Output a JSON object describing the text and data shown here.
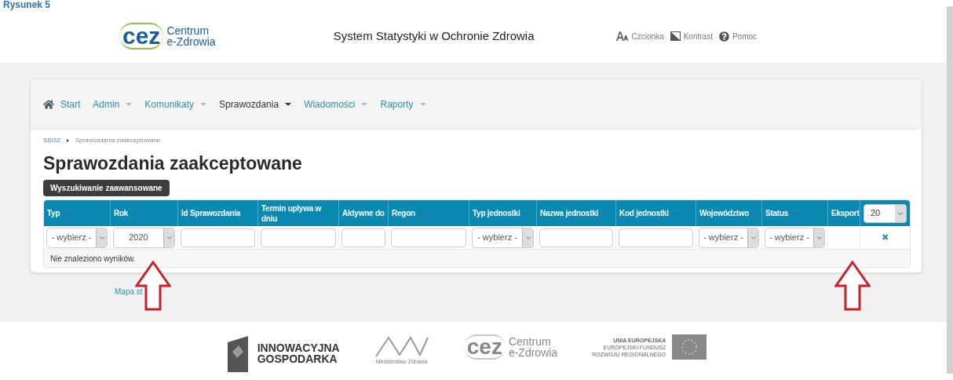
{
  "caption": "Rysunek 5",
  "header": {
    "logo": {
      "mark": "cez",
      "line1": "Centrum",
      "line2": "e-Zdrowia"
    },
    "title": "System Statystyki w Ochronie Zdrowia",
    "tools": [
      {
        "kind": "font",
        "label": "Czcionka"
      },
      {
        "kind": "contrast",
        "label": "Kontrast"
      },
      {
        "kind": "help",
        "label": "Pomoc"
      }
    ]
  },
  "nav": [
    {
      "kind": "home",
      "label": "Start",
      "selected": false
    },
    {
      "kind": "menu",
      "label": "Admin",
      "selected": false
    },
    {
      "kind": "menu",
      "label": "Komunikaty",
      "selected": false
    },
    {
      "kind": "menu",
      "label": "Sprawozdania",
      "selected": true
    },
    {
      "kind": "menu",
      "label": "Wiadomości",
      "selected": false
    },
    {
      "kind": "menu",
      "label": "Raporty",
      "selected": false
    }
  ],
  "breadcrumb": [
    "SSOZ",
    "Sprawozdania zaakceptowane"
  ],
  "heading": "Sprawozdania zaakceptowane",
  "advanced_button": "Wyszukiwanie zaawansowane",
  "table": {
    "columns": [
      {
        "label": "Typ",
        "sortable": true,
        "filter": {
          "kind": "select",
          "value": "- wybierz -"
        }
      },
      {
        "label": "Rok",
        "sortable": true,
        "filter": {
          "kind": "select",
          "value": "2020"
        }
      },
      {
        "label": "Id Sprawozdania",
        "sortable": false,
        "filter": {
          "kind": "input"
        }
      },
      {
        "label": "Termin upływa w dniu",
        "sortable": false,
        "filter": {
          "kind": "input"
        }
      },
      {
        "label": "Aktywne do",
        "sortable": false,
        "filter": {
          "kind": "input"
        }
      },
      {
        "label": "Regon",
        "sortable": true,
        "filter": {
          "kind": "input"
        }
      },
      {
        "label": "Typ jednostki",
        "sortable": true,
        "filter": {
          "kind": "select",
          "value": "- wybierz -"
        }
      },
      {
        "label": "Nazwa jednostki",
        "sortable": true,
        "filter": {
          "kind": "input"
        }
      },
      {
        "label": "Kod jednostki",
        "sortable": true,
        "filter": {
          "kind": "input"
        }
      },
      {
        "label": "Województwo",
        "sortable": true,
        "filter": {
          "kind": "select",
          "value": "- wybierz -"
        }
      },
      {
        "label": "Status",
        "sortable": true,
        "filter": {
          "kind": "select",
          "value": "- wybierz -"
        }
      },
      {
        "label": "Eksport",
        "sortable": false,
        "filter": {
          "kind": "none"
        }
      }
    ],
    "page_size": "20",
    "clear_icon": "✖",
    "empty_message": "Nie znaleziono wyników."
  },
  "sitemap_link": "Mapa st",
  "footer": {
    "innowacyjna": [
      "INNOWACYJNA",
      "GOSPODARKA"
    ],
    "ministry": "Ministerstwo Zdrowia",
    "cez": {
      "mark": "cez",
      "line1": "Centrum",
      "line2": "e-Zdrowia"
    },
    "eu": [
      "UNIA EUROPEJSKA",
      "EUROPEJSKI FUNDUSZ",
      "ROZWOJU REGIONALNEGO"
    ]
  }
}
